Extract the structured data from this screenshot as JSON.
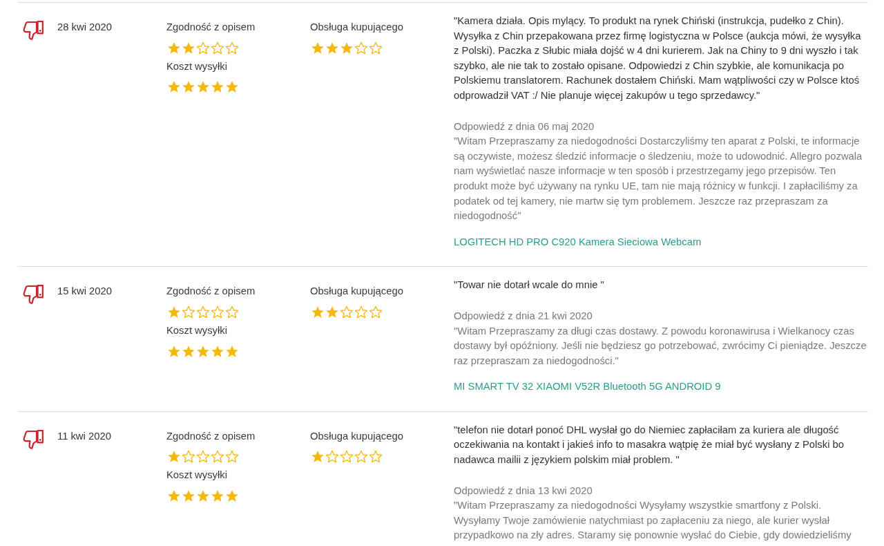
{
  "reviews": [
    {
      "kind": "negative",
      "date": "28 kwi 2020",
      "ratings": [
        {
          "label": "Zgodność z opisem",
          "stars": 2
        },
        {
          "label": "Obsługa kupującego",
          "stars": 3
        },
        {
          "label": "Koszt wysyłki",
          "stars": 5
        }
      ],
      "comment": "\"Kamera działa. Opis mylący. To produkt na rynek Chiński (instrukcja, pudełko z Chin). Wysyłka z Chin przepakowana przez firmę logistyczna w Polsce (aukcja mówi, że wysyłka z Polski). Paczka z Słubic miała dojść w 4 dni kurierem. Jak na Chiny to 9 dni wyszło i tak szybko, ale nie tak to zostało opisane. Odpowiedzi z Chin szybkie, ale komunikacja po Polskiemu translatorem. Rachunek dostałem Chiński. Mam wątpliwości czy w Polsce ktoś odprowadził VAT :/ Nie planuje więcej zakupów u tego sprzedawcy.\"",
      "reply": {
        "heading": "Odpowiedź z dnia 06 maj 2020",
        "text": "\"Witam Przepraszamy za niedogodności Dostarczyliśmy ten aparat z Polski, te informacje są oczywiste, możesz śledzić informacje o śledzeniu, może to udowodnić. Allegro pozwala nam wyświetlać nasze informacje w ten sposób i przestrzegamy jego przepisów. Ten produkt może być używany na rynku UE, tam nie mają różnicy w funkcji. I zapłaciliśmy za podatek od tej kamery, nie martw się tym problemem. Jeszcze raz przepraszam za niedogodność\""
      },
      "product_link": "LOGITECH HD PRO C920 Kamera Sieciowa Webcam"
    },
    {
      "kind": "negative",
      "date": "15 kwi 2020",
      "ratings": [
        {
          "label": "Zgodność z opisem",
          "stars": 1
        },
        {
          "label": "Obsługa kupującego",
          "stars": 2
        },
        {
          "label": "Koszt wysyłki",
          "stars": 5
        }
      ],
      "comment": "\"Towar nie dotarł wcale do mnie \"",
      "reply": {
        "heading": "Odpowiedź z dnia 21 kwi 2020",
        "text": "\"Witam Przepraszamy za długi czas dostawy. Z powodu koronawirusa i Wielkanocy czas dostawy był opóźniony. Jeśli nie będziesz go potrzebować, zwrócimy Ci pieniądze. Jeszcze raz przepraszam za niedogodności.\""
      },
      "product_link": "MI SMART TV 32 XIAOMI V52R Bluetooth 5G ANDROID 9"
    },
    {
      "kind": "negative",
      "date": "11 kwi 2020",
      "ratings": [
        {
          "label": "Zgodność z opisem",
          "stars": 1
        },
        {
          "label": "Obsługa kupującego",
          "stars": 1
        },
        {
          "label": "Koszt wysyłki",
          "stars": 5
        }
      ],
      "comment": "\"telefon nie dotarł ponoć DHL wysłał go do Niemiec zapłaciłam za kuriera ale długość oczekiwania na kontakt i jakieś info to masakra wątpię że miał być wysłany z Polski bo nadawca mailii z językiem polskim miał problem. \"",
      "reply": {
        "heading": "Odpowiedź z dnia 13 kwi 2020",
        "text": "\"Witam Przepraszamy za niedogodności Wysyłamy wszystkie smartfony z Polski. Wysyłamy Twoje zamówienie natychmiast po zapłaceniu za niego, ale kurier wysłał przypadkowo na zły adres. Staramy się ponownie wysłać do Ciebie, gdy dowiedzieliśmy"
      }
    }
  ]
}
